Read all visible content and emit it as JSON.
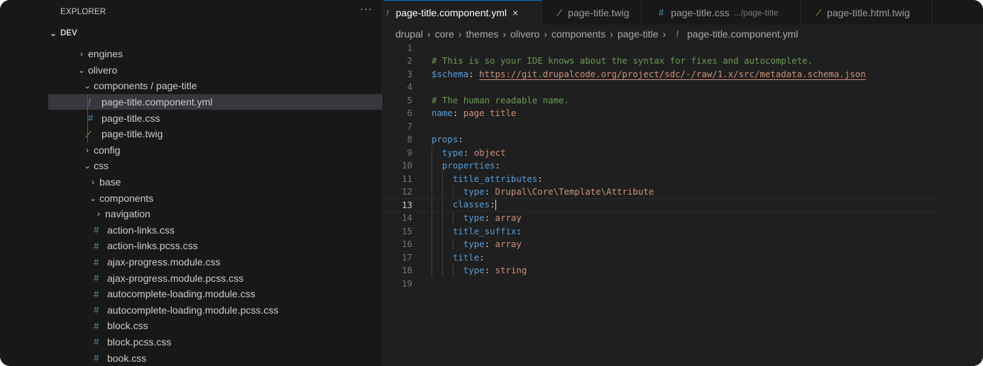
{
  "sidebar": {
    "title": "EXPLORER",
    "more": "···",
    "root": "DEV",
    "items": [
      {
        "label": "engines",
        "type": "folder",
        "open": false,
        "depth": 0
      },
      {
        "label": "olivero",
        "type": "folder",
        "open": true,
        "depth": 0
      },
      {
        "label": "components / page-title",
        "type": "folder",
        "open": true,
        "depth": 1
      },
      {
        "label": "page-title.component.yml",
        "type": "yml",
        "depth": 2,
        "selected": true
      },
      {
        "label": "page-title.css",
        "type": "css",
        "depth": 2
      },
      {
        "label": "page-title.twig",
        "type": "twig",
        "depth": 2
      },
      {
        "label": "config",
        "type": "folder",
        "open": false,
        "depth": 1
      },
      {
        "label": "css",
        "type": "folder",
        "open": true,
        "depth": 1
      },
      {
        "label": "base",
        "type": "folder",
        "open": false,
        "depth": 2
      },
      {
        "label": "components",
        "type": "folder",
        "open": true,
        "depth": 2
      },
      {
        "label": "navigation",
        "type": "folder",
        "open": false,
        "depth": 3
      },
      {
        "label": "action-links.css",
        "type": "css",
        "depth": 3
      },
      {
        "label": "action-links.pcss.css",
        "type": "css",
        "depth": 3
      },
      {
        "label": "ajax-progress.module.css",
        "type": "css",
        "depth": 3
      },
      {
        "label": "ajax-progress.module.pcss.css",
        "type": "css",
        "depth": 3
      },
      {
        "label": "autocomplete-loading.module.css",
        "type": "css",
        "depth": 3
      },
      {
        "label": "autocomplete-loading.module.pcss.css",
        "type": "css",
        "depth": 3
      },
      {
        "label": "block.css",
        "type": "css",
        "depth": 3
      },
      {
        "label": "block.pcss.css",
        "type": "css",
        "depth": 3
      },
      {
        "label": "book.css",
        "type": "css",
        "depth": 3
      }
    ]
  },
  "tabs": [
    {
      "label": "page-title.component.yml",
      "type": "yml",
      "active": true,
      "close": "×"
    },
    {
      "label": "page-title.twig",
      "type": "twig"
    },
    {
      "label": "page-title.css",
      "type": "css",
      "desc": ".../page-title"
    },
    {
      "label": "page-title.html.twig",
      "type": "twig"
    }
  ],
  "breadcrumb": [
    "drupal",
    "core",
    "themes",
    "olivero",
    "components",
    "page-title",
    "page-title.component.yml"
  ],
  "icons": {
    "yml": {
      "glyph": "!",
      "color": "#a074c4"
    },
    "css": {
      "glyph": "#",
      "color": "#519aba"
    },
    "twig": {
      "glyph": "⁄",
      "color": "#8dc149"
    },
    "folder_open": "⌄",
    "folder_closed": "›"
  },
  "editor": {
    "current_line": 13,
    "lines": [
      [],
      [
        {
          "t": "c",
          "s": "# This is so your IDE knows about the syntax for fixes and autocomplete."
        }
      ],
      [
        {
          "t": "k",
          "s": "$schema"
        },
        {
          "t": "p",
          "s": ": "
        },
        {
          "t": "u",
          "s": "https://git.drupalcode.org/project/sdc/-/raw/1.x/src/metadata.schema.json"
        }
      ],
      [],
      [
        {
          "t": "c",
          "s": "# The human readable name."
        }
      ],
      [
        {
          "t": "k",
          "s": "name"
        },
        {
          "t": "p",
          "s": ": "
        },
        {
          "t": "v",
          "s": "page title"
        }
      ],
      [],
      [
        {
          "t": "k",
          "s": "props"
        },
        {
          "t": "p",
          "s": ":"
        }
      ],
      [
        {
          "t": "p",
          "s": "  "
        },
        {
          "t": "k",
          "s": "type"
        },
        {
          "t": "p",
          "s": ": "
        },
        {
          "t": "v",
          "s": "object"
        }
      ],
      [
        {
          "t": "p",
          "s": "  "
        },
        {
          "t": "k",
          "s": "properties"
        },
        {
          "t": "p",
          "s": ":"
        }
      ],
      [
        {
          "t": "p",
          "s": "    "
        },
        {
          "t": "k",
          "s": "title_attributes"
        },
        {
          "t": "p",
          "s": ":"
        }
      ],
      [
        {
          "t": "p",
          "s": "      "
        },
        {
          "t": "k",
          "s": "type"
        },
        {
          "t": "p",
          "s": ": "
        },
        {
          "t": "v",
          "s": "Drupal\\Core\\Template\\Attribute"
        }
      ],
      [
        {
          "t": "p",
          "s": "    "
        },
        {
          "t": "k",
          "s": "classes"
        },
        {
          "t": "p",
          "s": ":"
        }
      ],
      [
        {
          "t": "p",
          "s": "      "
        },
        {
          "t": "k",
          "s": "type"
        },
        {
          "t": "p",
          "s": ": "
        },
        {
          "t": "v",
          "s": "array"
        }
      ],
      [
        {
          "t": "p",
          "s": "    "
        },
        {
          "t": "k",
          "s": "title_suffix"
        },
        {
          "t": "p",
          "s": ":"
        }
      ],
      [
        {
          "t": "p",
          "s": "      "
        },
        {
          "t": "k",
          "s": "type"
        },
        {
          "t": "p",
          "s": ": "
        },
        {
          "t": "v",
          "s": "array"
        }
      ],
      [
        {
          "t": "p",
          "s": "    "
        },
        {
          "t": "k",
          "s": "title"
        },
        {
          "t": "p",
          "s": ":"
        }
      ],
      [
        {
          "t": "p",
          "s": "      "
        },
        {
          "t": "k",
          "s": "type"
        },
        {
          "t": "p",
          "s": ": "
        },
        {
          "t": "v",
          "s": "string"
        }
      ],
      []
    ]
  }
}
